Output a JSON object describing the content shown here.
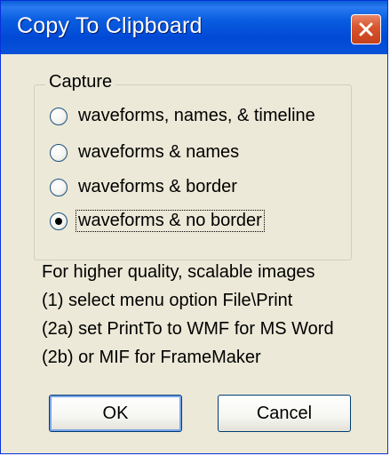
{
  "window": {
    "title": "Copy To Clipboard"
  },
  "capture_group": {
    "label": "Capture",
    "options": [
      {
        "label": "waveforms, names, & timeline",
        "selected": false
      },
      {
        "label": "waveforms & names",
        "selected": false
      },
      {
        "label": "waveforms & border",
        "selected": false
      },
      {
        "label": "waveforms & no border",
        "selected": true
      }
    ]
  },
  "info_lines": [
    "For higher quality, scalable images",
    "(1) select menu option File\\Print",
    "(2a) set PrintTo to WMF for MS Word",
    "(2b) or MIF for FrameMaker"
  ],
  "buttons": {
    "ok_label": "OK",
    "cancel_label": "Cancel"
  },
  "colors": {
    "titlebar": "#0a52d8",
    "dialog_bg": "#ece9d8",
    "close_button": "#d9562f"
  }
}
